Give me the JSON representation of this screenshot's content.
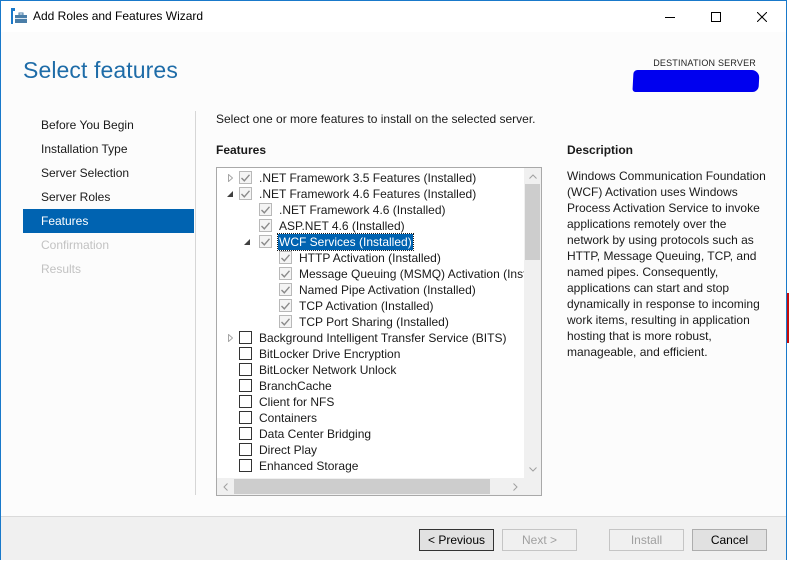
{
  "window": {
    "title": "Add Roles and Features Wizard",
    "controls": [
      "minimize",
      "maximize",
      "close"
    ]
  },
  "header": {
    "page_title": "Select features",
    "destination_label": "DESTINATION SERVER",
    "destination_value": "[redacted]"
  },
  "nav": {
    "items": [
      {
        "label": "Before You Begin",
        "state": "normal"
      },
      {
        "label": "Installation Type",
        "state": "normal"
      },
      {
        "label": "Server Selection",
        "state": "normal"
      },
      {
        "label": "Server Roles",
        "state": "normal"
      },
      {
        "label": "Features",
        "state": "active"
      },
      {
        "label": "Confirmation",
        "state": "disabled"
      },
      {
        "label": "Results",
        "state": "disabled"
      }
    ]
  },
  "main": {
    "instruction": "Select one or more features to install on the selected server.",
    "features_heading": "Features",
    "tree": [
      {
        "label": ".NET Framework 3.5 Features (Installed)",
        "level": 0,
        "expander": "collapsed",
        "checked": true,
        "installed": true
      },
      {
        "label": ".NET Framework 4.6 Features (Installed)",
        "level": 0,
        "expander": "expanded",
        "checked": true,
        "installed": true
      },
      {
        "label": ".NET Framework 4.6 (Installed)",
        "level": 1,
        "expander": "none",
        "checked": true,
        "installed": true
      },
      {
        "label": "ASP.NET 4.6 (Installed)",
        "level": 1,
        "expander": "none",
        "checked": true,
        "installed": true
      },
      {
        "label": "WCF Services (Installed)",
        "level": 1,
        "expander": "expanded",
        "checked": true,
        "installed": true,
        "selected": true
      },
      {
        "label": "HTTP Activation (Installed)",
        "level": 2,
        "expander": "none",
        "checked": true,
        "installed": true
      },
      {
        "label": "Message Queuing (MSMQ) Activation (Installed)",
        "level": 2,
        "expander": "none",
        "checked": true,
        "installed": true
      },
      {
        "label": "Named Pipe Activation (Installed)",
        "level": 2,
        "expander": "none",
        "checked": true,
        "installed": true
      },
      {
        "label": "TCP Activation (Installed)",
        "level": 2,
        "expander": "none",
        "checked": true,
        "installed": true
      },
      {
        "label": "TCP Port Sharing (Installed)",
        "level": 2,
        "expander": "none",
        "checked": true,
        "installed": true
      },
      {
        "label": "Background Intelligent Transfer Service (BITS)",
        "level": 0,
        "expander": "collapsed",
        "checked": false
      },
      {
        "label": "BitLocker Drive Encryption",
        "level": 0,
        "expander": "none",
        "checked": false
      },
      {
        "label": "BitLocker Network Unlock",
        "level": 0,
        "expander": "none",
        "checked": false
      },
      {
        "label": "BranchCache",
        "level": 0,
        "expander": "none",
        "checked": false
      },
      {
        "label": "Client for NFS",
        "level": 0,
        "expander": "none",
        "checked": false
      },
      {
        "label": "Containers",
        "level": 0,
        "expander": "none",
        "checked": false
      },
      {
        "label": "Data Center Bridging",
        "level": 0,
        "expander": "none",
        "checked": false
      },
      {
        "label": "Direct Play",
        "level": 0,
        "expander": "none",
        "checked": false
      },
      {
        "label": "Enhanced Storage",
        "level": 0,
        "expander": "none",
        "checked": false
      }
    ],
    "scroll": {
      "vertical_position": 0.0,
      "horizontal_position": 0.0
    }
  },
  "description": {
    "heading": "Description",
    "text": "Windows Communication Foundation (WCF) Activation uses Windows Process Activation Service to invoke applications remotely over the network by using protocols such as HTTP, Message Queuing, TCP, and named pipes. Consequently, applications can start and stop dynamically in response to incoming work items, resulting in application hosting that is more robust, manageable, and efficient."
  },
  "footer": {
    "previous_label": "< Previous",
    "next_label": "Next >",
    "install_label": "Install",
    "cancel_label": "Cancel",
    "next_enabled": false,
    "install_enabled": false
  },
  "colors": {
    "accent": "#0063b1",
    "title_blue": "#1e6ca8",
    "window_border": "#1979ca",
    "redaction": "#0000ef"
  }
}
